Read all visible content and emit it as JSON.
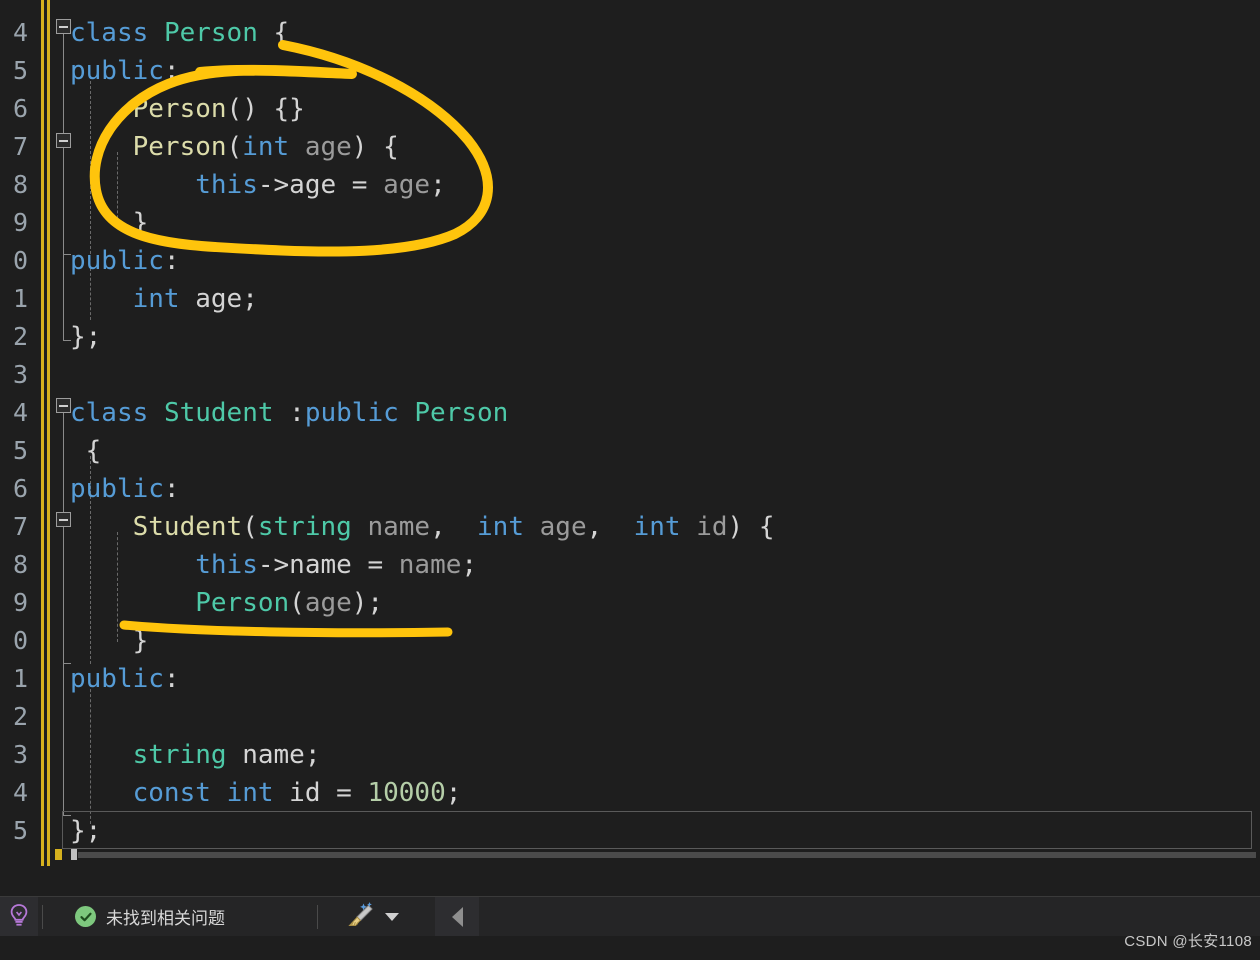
{
  "editor": {
    "language": "cpp",
    "background_color": "#1e1e1e",
    "line_numbers": [
      "4",
      "5",
      "6",
      "7",
      "8",
      "9",
      "0",
      "1",
      "2",
      "3",
      "4",
      "5",
      "6",
      "7",
      "8",
      "9",
      "0",
      "1",
      "2",
      "3",
      "4",
      "5"
    ],
    "lines": [
      {
        "num": "4",
        "text": "class Person {",
        "tokens": [
          {
            "t": "class",
            "c": "kw"
          },
          {
            "t": " ",
            "c": "plain"
          },
          {
            "t": "Person",
            "c": "type"
          },
          {
            "t": " {",
            "c": "plain"
          }
        ]
      },
      {
        "num": "5",
        "text": "public:",
        "tokens": [
          {
            "t": "public",
            "c": "kw"
          },
          {
            "t": ":",
            "c": "plain"
          }
        ]
      },
      {
        "num": "6",
        "text": "    Person() {}",
        "tokens": [
          {
            "t": "    ",
            "c": "plain"
          },
          {
            "t": "Person",
            "c": "fn"
          },
          {
            "t": "() {}",
            "c": "plain"
          }
        ]
      },
      {
        "num": "7",
        "text": "    Person(int age) {",
        "tokens": [
          {
            "t": "    ",
            "c": "plain"
          },
          {
            "t": "Person",
            "c": "fn"
          },
          {
            "t": "(",
            "c": "plain"
          },
          {
            "t": "int",
            "c": "kw"
          },
          {
            "t": " ",
            "c": "plain"
          },
          {
            "t": "age",
            "c": "var"
          },
          {
            "t": ") {",
            "c": "plain"
          }
        ]
      },
      {
        "num": "8",
        "text": "        this->age = age;",
        "tokens": [
          {
            "t": "        ",
            "c": "plain"
          },
          {
            "t": "this",
            "c": "kw"
          },
          {
            "t": "->",
            "c": "plain"
          },
          {
            "t": "age",
            "c": "plain"
          },
          {
            "t": " = ",
            "c": "plain"
          },
          {
            "t": "age",
            "c": "var"
          },
          {
            "t": ";",
            "c": "plain"
          }
        ]
      },
      {
        "num": "9",
        "text": "    }",
        "tokens": [
          {
            "t": "    }",
            "c": "plain"
          }
        ]
      },
      {
        "num": "0",
        "text": "public:",
        "tokens": [
          {
            "t": "public",
            "c": "kw"
          },
          {
            "t": ":",
            "c": "plain"
          }
        ]
      },
      {
        "num": "1",
        "text": "    int age;",
        "tokens": [
          {
            "t": "    ",
            "c": "plain"
          },
          {
            "t": "int",
            "c": "kw"
          },
          {
            "t": " age;",
            "c": "plain"
          }
        ]
      },
      {
        "num": "2",
        "text": "};",
        "tokens": [
          {
            "t": "};",
            "c": "plain"
          }
        ]
      },
      {
        "num": "3",
        "text": "",
        "tokens": []
      },
      {
        "num": "4",
        "text": "class Student :public Person",
        "tokens": [
          {
            "t": "class",
            "c": "kw"
          },
          {
            "t": " ",
            "c": "plain"
          },
          {
            "t": "Student",
            "c": "type"
          },
          {
            "t": " :",
            "c": "plain"
          },
          {
            "t": "public",
            "c": "kw"
          },
          {
            "t": " ",
            "c": "plain"
          },
          {
            "t": "Person",
            "c": "type"
          }
        ]
      },
      {
        "num": "5",
        "text": " {",
        "tokens": [
          {
            "t": " {",
            "c": "plain"
          }
        ]
      },
      {
        "num": "6",
        "text": "public:",
        "tokens": [
          {
            "t": "public",
            "c": "kw"
          },
          {
            "t": ":",
            "c": "plain"
          }
        ]
      },
      {
        "num": "7",
        "text": "    Student(string name, int age, int id) {",
        "tokens": [
          {
            "t": "    ",
            "c": "plain"
          },
          {
            "t": "Student",
            "c": "fn"
          },
          {
            "t": "(",
            "c": "plain"
          },
          {
            "t": "string",
            "c": "type"
          },
          {
            "t": " ",
            "c": "plain"
          },
          {
            "t": "name",
            "c": "var"
          },
          {
            "t": ",  ",
            "c": "plain"
          },
          {
            "t": "int",
            "c": "kw"
          },
          {
            "t": " ",
            "c": "plain"
          },
          {
            "t": "age",
            "c": "var"
          },
          {
            "t": ",  ",
            "c": "plain"
          },
          {
            "t": "int",
            "c": "kw"
          },
          {
            "t": " ",
            "c": "plain"
          },
          {
            "t": "id",
            "c": "var"
          },
          {
            "t": ") {",
            "c": "plain"
          }
        ]
      },
      {
        "num": "8",
        "text": "        this->name = name;",
        "tokens": [
          {
            "t": "        ",
            "c": "plain"
          },
          {
            "t": "this",
            "c": "kw"
          },
          {
            "t": "->",
            "c": "plain"
          },
          {
            "t": "name",
            "c": "plain"
          },
          {
            "t": " = ",
            "c": "plain"
          },
          {
            "t": "name",
            "c": "var"
          },
          {
            "t": ";",
            "c": "plain"
          }
        ]
      },
      {
        "num": "9",
        "text": "        Person(age);",
        "tokens": [
          {
            "t": "        ",
            "c": "plain"
          },
          {
            "t": "Person",
            "c": "type"
          },
          {
            "t": "(",
            "c": "plain"
          },
          {
            "t": "age",
            "c": "var"
          },
          {
            "t": ");",
            "c": "plain"
          }
        ]
      },
      {
        "num": "0",
        "text": "    }",
        "tokens": [
          {
            "t": "    }",
            "c": "plain"
          }
        ]
      },
      {
        "num": "1",
        "text": "public:",
        "tokens": [
          {
            "t": "public",
            "c": "kw"
          },
          {
            "t": ":",
            "c": "plain"
          }
        ]
      },
      {
        "num": "2",
        "text": "",
        "tokens": []
      },
      {
        "num": "3",
        "text": "    string name;",
        "tokens": [
          {
            "t": "    ",
            "c": "plain"
          },
          {
            "t": "string",
            "c": "type"
          },
          {
            "t": " name;",
            "c": "plain"
          }
        ]
      },
      {
        "num": "4",
        "text": "    const int id = 10000;",
        "tokens": [
          {
            "t": "    ",
            "c": "plain"
          },
          {
            "t": "const",
            "c": "kw"
          },
          {
            "t": " ",
            "c": "plain"
          },
          {
            "t": "int",
            "c": "kw"
          },
          {
            "t": " id = ",
            "c": "plain"
          },
          {
            "t": "10000",
            "c": "num"
          },
          {
            "t": ";",
            "c": "plain"
          }
        ]
      },
      {
        "num": "5",
        "text": "};",
        "tokens": [
          {
            "t": "};",
            "c": "plain"
          }
        ]
      }
    ]
  },
  "annotations": {
    "stroke_color": "#FFC40C",
    "items": [
      {
        "name": "ellipse-around-person-constructors",
        "shape": "ellipse"
      },
      {
        "name": "underline-below-person-age-call",
        "shape": "underline"
      }
    ]
  },
  "statusbar": {
    "lightbulb_icon": "lightbulb-icon",
    "status_icon": "check-circle-icon",
    "status_text": "未找到相关问题",
    "cleanup_icon": "broom-icon",
    "cleanup_caret": "chevron-down-icon",
    "nav_back_icon": "caret-left-icon"
  },
  "watermark": {
    "text": "CSDN @长安1108"
  }
}
